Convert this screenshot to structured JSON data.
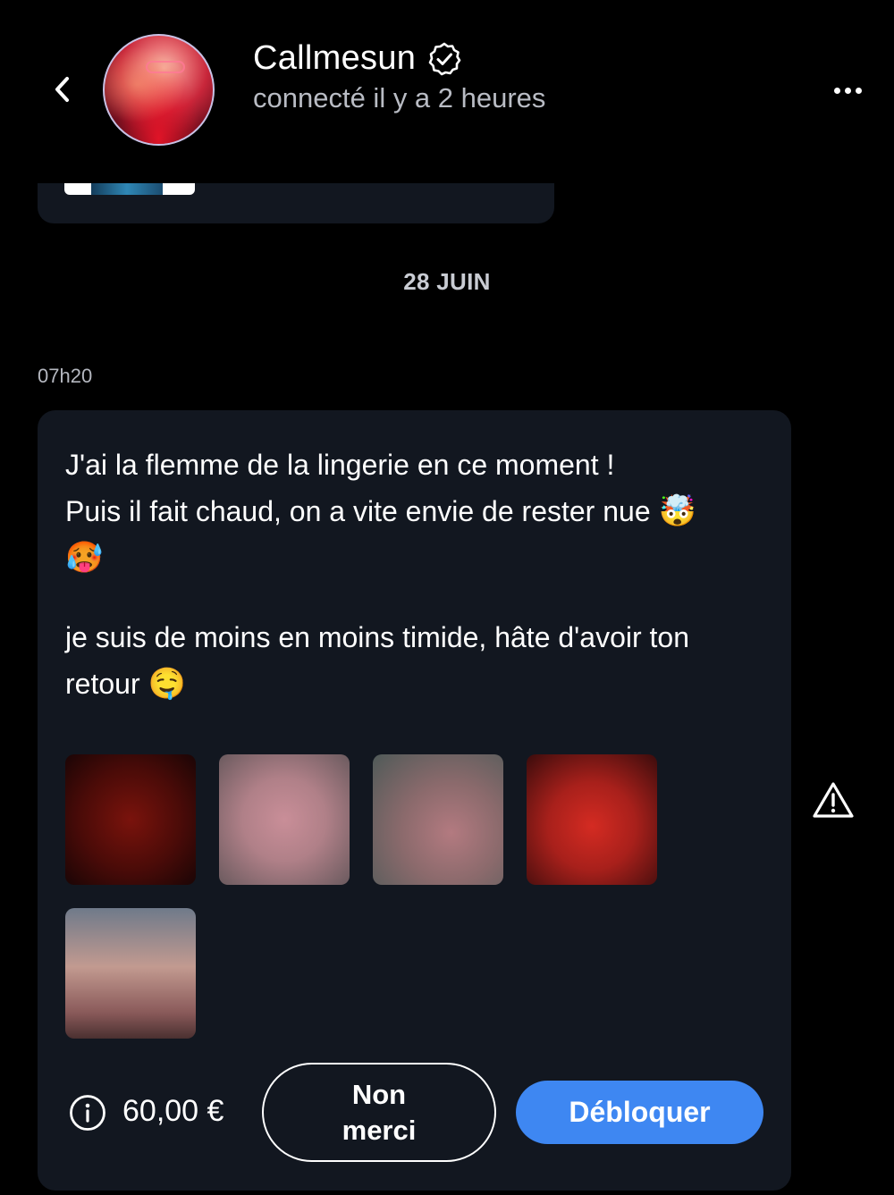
{
  "header": {
    "back_icon": "chevron-left-icon",
    "contact_name": "Callmesun",
    "verified_icon": "verified-badge-icon",
    "status": "connecté il y a 2 heures",
    "more_icon": "more-horizontal-icon"
  },
  "conversation": {
    "date_separator": "28 JUIN",
    "message": {
      "time": "07h20",
      "line1": "J'ai la flemme de la lingerie en ce moment !",
      "line2": "Puis il fait chaud, on a vite envie de rester nue",
      "emoji1": "🤯",
      "emoji2": "🥵",
      "line3": "je suis de moins en moins timide, hâte d'avoir ton",
      "line4": "retour",
      "emoji3": "🤤",
      "locked_media_count": 5,
      "price": "60,00 €",
      "decline_label": "Non merci",
      "unlock_label": "Débloquer"
    },
    "report_icon": "warning-triangle-icon"
  },
  "colors": {
    "background": "#000000",
    "bubble": "#121720",
    "accent": "#3e87f2",
    "secondary_text": "#b9bcc4"
  }
}
